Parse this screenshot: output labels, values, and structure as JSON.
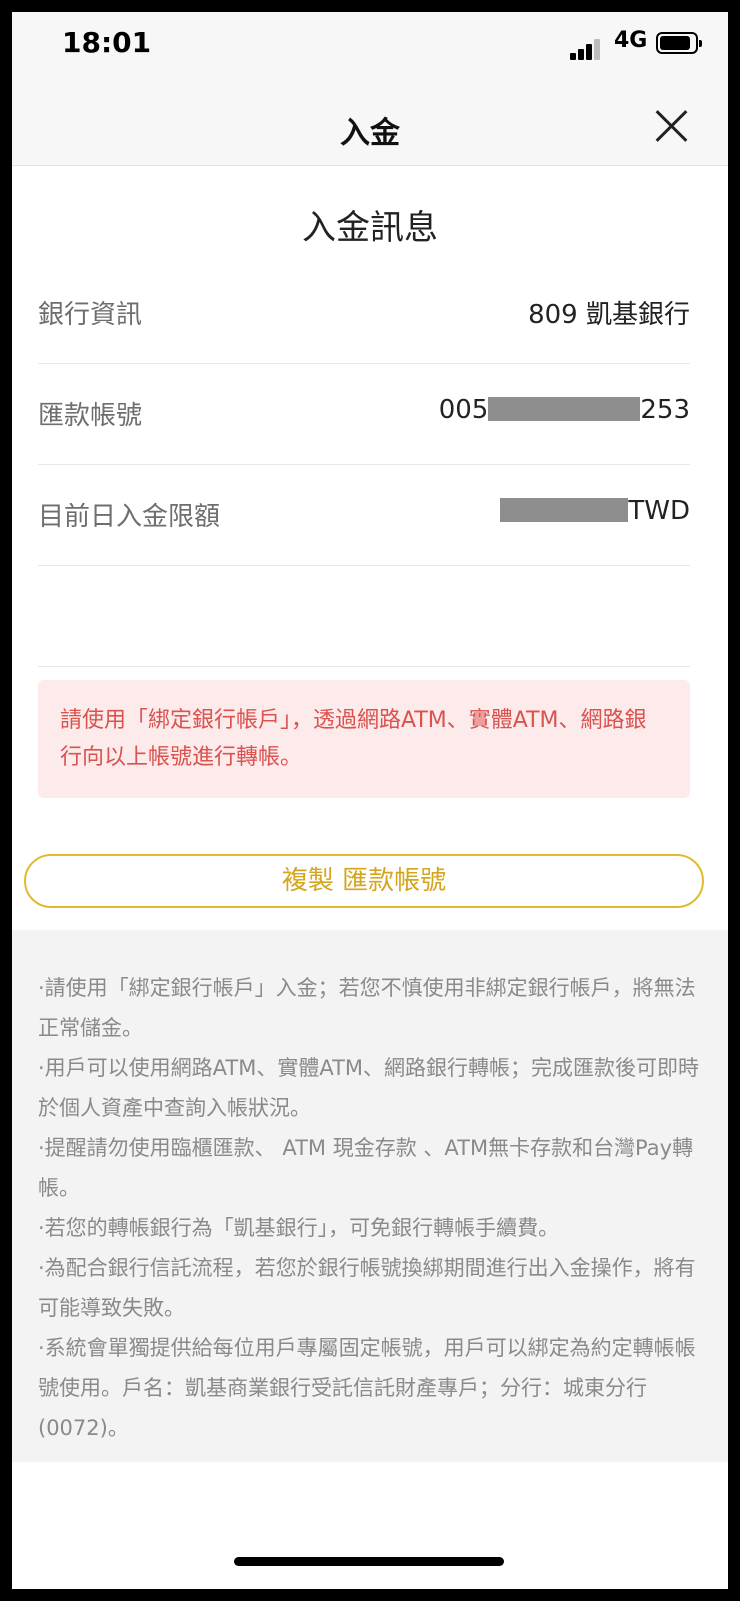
{
  "status_bar": {
    "time": "18:01",
    "network": "4G"
  },
  "nav": {
    "title": "入金",
    "close_icon": "close-icon"
  },
  "section_title": "入金訊息",
  "rows": [
    {
      "label": "銀行資訊",
      "value": "809 凱基銀行"
    },
    {
      "label": "匯款帳號",
      "prefix": "005",
      "suffix": "253"
    },
    {
      "label": "目前日入金限額",
      "unit": "TWD"
    }
  ],
  "alert_text": "請使用「綁定銀行帳戶」，透過網路ATM、實體ATM、網路銀行向以上帳號進行轉帳。",
  "copy_button_label": "複製 匯款帳號",
  "notes": [
    "·請使用「綁定銀行帳戶」入金；若您不慎使用非綁定銀行帳戶，將無法正常儲金。",
    "·用戶可以使用網路ATM、實體ATM、網路銀行轉帳；完成匯款後可即時於個人資產中查詢入帳狀況。",
    "·提醒請勿使用臨櫃匯款、 ATM 現金存款 、ATM無卡存款和台灣Pay轉帳。",
    "·若您的轉帳銀行為「凱基銀行」，可免銀行轉帳手續費。",
    "·為配合銀行信託流程，若您於銀行帳號換綁期間進行出入金操作，將有可能導致失敗。",
    "·系統會單獨提供給每位用戶專屬固定帳號，用戶可以綁定為約定轉帳帳號使用。戶名：凱基商業銀行受託信託財產專戶；分行：城東分行(0072)。"
  ],
  "colors": {
    "accent": "#e0bb2e",
    "alert_text": "#d9534f",
    "alert_bg": "#fdeaea"
  }
}
